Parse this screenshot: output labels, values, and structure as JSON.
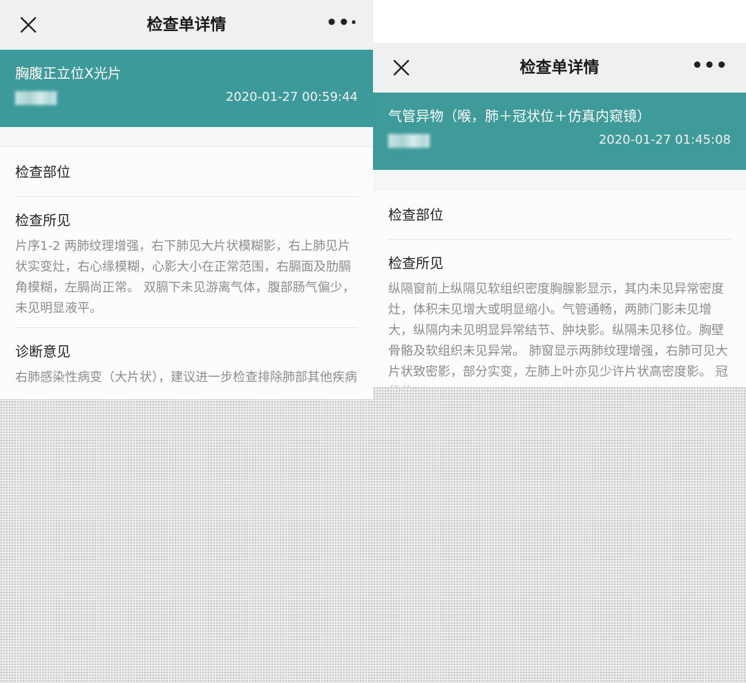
{
  "left": {
    "nav": {
      "close_icon": "close-icon",
      "title": "检查单详情",
      "more_label": "••·"
    },
    "header": {
      "exam_name": "胸腹正立位X光片",
      "datetime": "2020-01-27 00:59:44"
    },
    "sections": {
      "site_label": "检查部位",
      "findings_label": "检查所见",
      "findings_text": "片序1-2 两肺纹理增强，右下肺见大片状模糊影，右上肺见片状实变灶，右心缘模糊，心影大小在正常范围，右膈面及肋膈角模糊，左膈尚正常。 双膈下未见游离气体，腹部肠气偏少，未见明显液平。",
      "diagnosis_label": "诊断意见",
      "diagnosis_text": "右肺感染性病变（大片状），建议进一步检查排除肺部其他疾病"
    }
  },
  "right": {
    "nav": {
      "close_icon": "close-icon",
      "title": "检查单详情",
      "more_label": "•••"
    },
    "header": {
      "exam_name": "气管异物（喉，肺＋冠状位＋仿真内窥镜）",
      "datetime": "2020-01-27 01:45:08"
    },
    "sections": {
      "site_label": "检查部位",
      "findings_label": "检查所见",
      "findings_text": "纵隔窗前上纵隔见软组织密度胸腺影显示，其内未见异常密度灶，体积未见增大或明显缩小。气管通畅，两肺门影未见增大，纵隔内未见明显异常结节、肿块影。纵隔未见移位。胸壁骨骼及软组织未见异常。 肺窗显示两肺纹理增强，右肺可见大片状致密影，部分实变，左肺上叶亦见少许片状高密度影。 冠状位"
    }
  }
}
